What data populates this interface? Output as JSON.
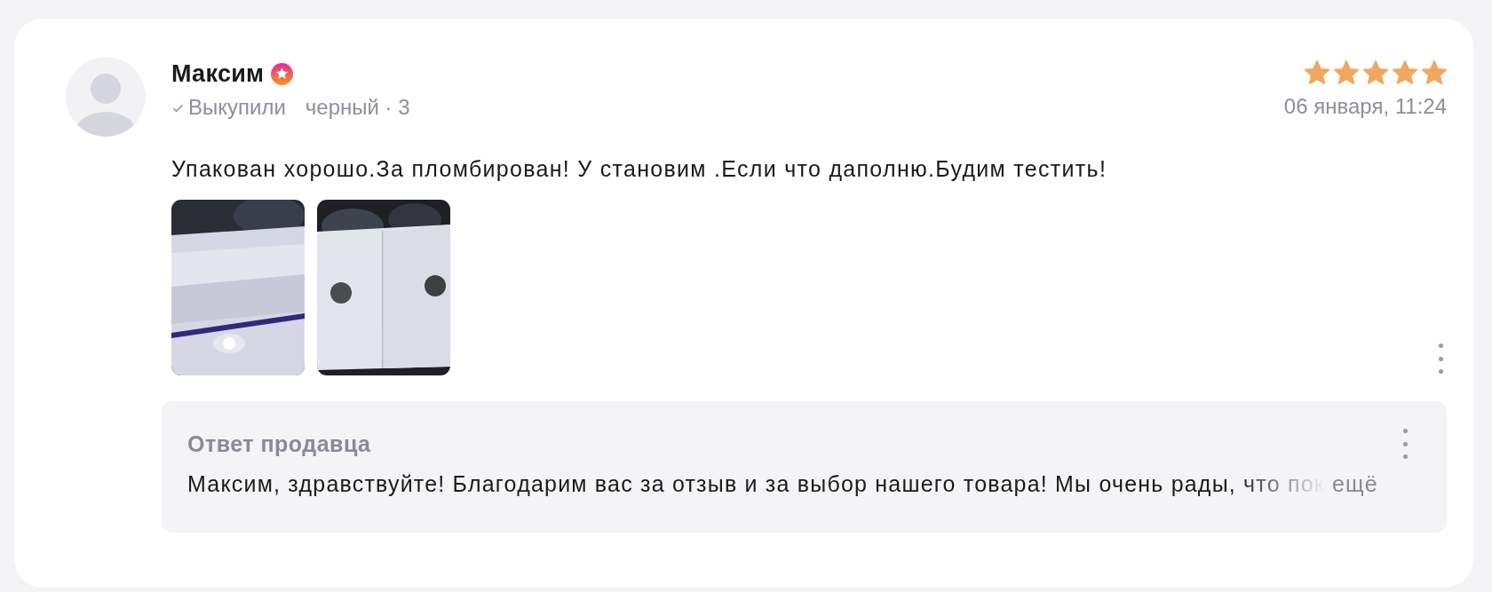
{
  "review": {
    "author": "Максим",
    "verified": "Выкупили",
    "variant": "черный · 3",
    "stars": 5,
    "date": "06 января, 11:24",
    "text": "Упакован хорошо.За пломбирован! У становим .Если что даполню.Будим тестить!",
    "photos": [
      {
        "kind": "picture"
      },
      {
        "kind": "picture"
      }
    ]
  },
  "seller_reply": {
    "title": "Ответ продавца",
    "text": "Максим, здравствуйте! Благодарим вас за отзыв и за выбор нашего товара! Мы очень рады, что пок",
    "more": "ещё"
  }
}
